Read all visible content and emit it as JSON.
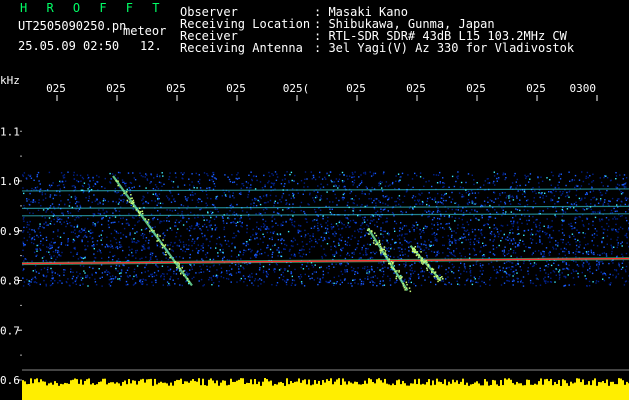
{
  "header": {
    "logo": "H R O F F T",
    "filename": "UT2505090250.pn",
    "kind": "meteor",
    "datetime": "25.05.09 02:50",
    "count": "12.",
    "info_labels": [
      "Observer",
      "Receiving Location",
      "Receiver",
      "Receiving Antenna"
    ],
    "info_values": [
      ": Masaki Kano",
      ": Shibukawa, Gunma, Japan",
      ": RTL-SDR SDR# 43dB L15 103.2MHz CW",
      ": 3el Yagi(V) Az 330 for Vladivostok"
    ]
  },
  "colors": {
    "background": "#000000",
    "noise_low": "#00208a",
    "noise_mid": "#1a5cff",
    "noise_high": "#3ef0ff",
    "signal": "#ff3030",
    "power": "#ffee00"
  },
  "chart_data": {
    "type": "heatmap",
    "title": "",
    "y_unit_label": "kHz",
    "y_ticks": [
      "1.0",
      "0.9",
      "0.8",
      "0.7",
      "0.6"
    ],
    "y_range": [
      0.6,
      1.0
    ],
    "x_ticks": [
      "025",
      "025",
      "025",
      "025",
      "025",
      "025",
      "025",
      "025",
      "025",
      "0300"
    ],
    "x_label_suffixes": [
      "",
      "",
      "",
      "",
      "(",
      "",
      "",
      "",
      "",
      ""
    ],
    "time_range": [
      "02:50",
      "03:00"
    ],
    "carrier_khz": 0.838,
    "noise_band_khz": [
      0.79,
      1.02
    ],
    "horizontal_lines_khz": [
      0.98,
      0.945,
      0.93
    ],
    "meteor_traces": [
      {
        "start_min": 1.5,
        "start_khz": 1.01,
        "end_min": 2.8,
        "end_khz": 0.79
      },
      {
        "start_min": 5.7,
        "start_khz": 0.905,
        "end_min": 6.35,
        "end_khz": 0.78
      },
      {
        "start_min": 6.4,
        "start_khz": 0.87,
        "end_min": 6.9,
        "end_khz": 0.8
      }
    ]
  }
}
